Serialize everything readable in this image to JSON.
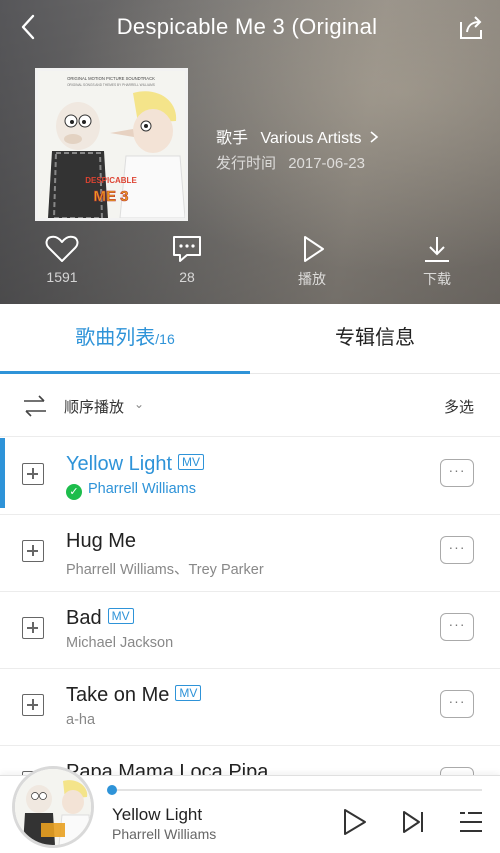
{
  "header": {
    "title": "Despicable Me 3 (Original",
    "artist_label": "歌手",
    "artist_value": "Various Artists",
    "date_label": "发行时间",
    "date_value": "2017-06-23",
    "cover_lines": {
      "top": "ORIGINAL MOTION PICTURE SOUNDTRACK",
      "sub": "ORIGINAL SONGS AND THEMES BY PHARRELL WILLIAMS",
      "logo1": "DESPICABLE",
      "logo2": "ME 3"
    }
  },
  "actions": [
    {
      "icon": "heart-icon",
      "label": "1591"
    },
    {
      "icon": "comment-icon",
      "label": "28"
    },
    {
      "icon": "play-icon",
      "label": "播放"
    },
    {
      "icon": "download-icon",
      "label": "下载"
    }
  ],
  "tabs": {
    "song_list": "歌曲列表",
    "song_count": "/16",
    "album_info": "专辑信息"
  },
  "modebar": {
    "mode_label": "顺序播放",
    "multi_select": "多选"
  },
  "songs": [
    {
      "title": "Yellow Light",
      "artist": "Pharrell Williams",
      "mv": "MV",
      "current": true
    },
    {
      "title": "Hug Me",
      "artist": "Pharrell Williams、Trey Parker",
      "mv": "",
      "current": false
    },
    {
      "title": "Bad",
      "artist": "Michael Jackson",
      "mv": "MV",
      "current": false
    },
    {
      "title": "Take on Me",
      "artist": "a-ha",
      "mv": "MV",
      "current": false
    },
    {
      "title": "Papa Mama Loca Pipa",
      "artist": "",
      "mv": "",
      "current": false
    }
  ],
  "more_label": "···",
  "player": {
    "title": "Yellow Light",
    "artist": "Pharrell Williams",
    "progress": 0.0
  },
  "colors": {
    "accent": "#2e93d8",
    "check": "#1dbd4c"
  }
}
